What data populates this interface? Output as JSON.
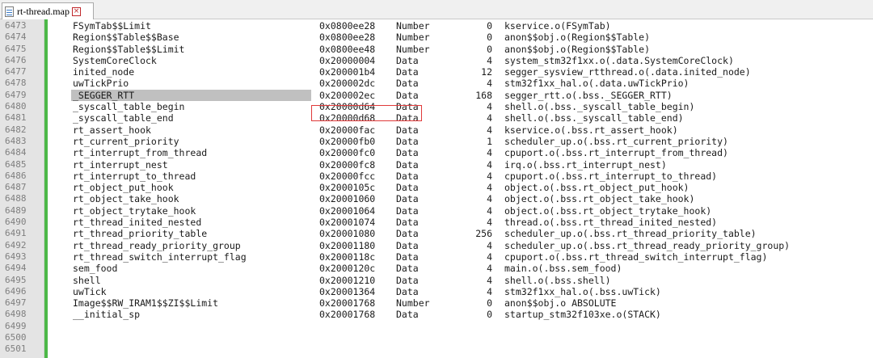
{
  "tab": {
    "title": "rt-thread.map",
    "close": "×"
  },
  "rows": [
    {
      "line": "6473",
      "symbol": "FSymTab$$Limit",
      "address": "0x0800ee28",
      "type": "Number",
      "size": "0",
      "object": "kservice.o(FSymTab)"
    },
    {
      "line": "6474",
      "symbol": "Region$$Table$$Base",
      "address": "0x0800ee28",
      "type": "Number",
      "size": "0",
      "object": "anon$$obj.o(Region$$Table)"
    },
    {
      "line": "6475",
      "symbol": "Region$$Table$$Limit",
      "address": "0x0800ee48",
      "type": "Number",
      "size": "0",
      "object": "anon$$obj.o(Region$$Table)"
    },
    {
      "line": "6476",
      "symbol": "SystemCoreClock",
      "address": "0x20000004",
      "type": "Data",
      "size": "4",
      "object": "system_stm32f1xx.o(.data.SystemCoreClock)"
    },
    {
      "line": "6477",
      "symbol": "inited_node",
      "address": "0x200001b4",
      "type": "Data",
      "size": "12",
      "object": "segger_sysview_rtthread.o(.data.inited_node)"
    },
    {
      "line": "6478",
      "symbol": "uwTickPrio",
      "address": "0x200002dc",
      "type": "Data",
      "size": "4",
      "object": "stm32f1xx_hal.o(.data.uwTickPrio)"
    },
    {
      "line": "6479",
      "symbol": "_SEGGER_RTT",
      "address": "0x200002ec",
      "type": "Data",
      "size": "168",
      "object": "segger_rtt.o(.bss._SEGGER_RTT)",
      "current": true
    },
    {
      "line": "6480",
      "symbol": "_syscall_table_begin",
      "address": "0x20000d64",
      "type": "Data",
      "size": "4",
      "object": "shell.o(.bss._syscall_table_begin)"
    },
    {
      "line": "6481",
      "symbol": "_syscall_table_end",
      "address": "0x20000d68",
      "type": "Data",
      "size": "4",
      "object": "shell.o(.bss._syscall_table_end)"
    },
    {
      "line": "6482",
      "symbol": "rt_assert_hook",
      "address": "0x20000fac",
      "type": "Data",
      "size": "4",
      "object": "kservice.o(.bss.rt_assert_hook)"
    },
    {
      "line": "6483",
      "symbol": "rt_current_priority",
      "address": "0x20000fb0",
      "type": "Data",
      "size": "1",
      "object": "scheduler_up.o(.bss.rt_current_priority)"
    },
    {
      "line": "6484",
      "symbol": "rt_interrupt_from_thread",
      "address": "0x20000fc0",
      "type": "Data",
      "size": "4",
      "object": "cpuport.o(.bss.rt_interrupt_from_thread)"
    },
    {
      "line": "6485",
      "symbol": "rt_interrupt_nest",
      "address": "0x20000fc8",
      "type": "Data",
      "size": "4",
      "object": "irq.o(.bss.rt_interrupt_nest)"
    },
    {
      "line": "6486",
      "symbol": "rt_interrupt_to_thread",
      "address": "0x20000fcc",
      "type": "Data",
      "size": "4",
      "object": "cpuport.o(.bss.rt_interrupt_to_thread)"
    },
    {
      "line": "6487",
      "symbol": "rt_object_put_hook",
      "address": "0x2000105c",
      "type": "Data",
      "size": "4",
      "object": "object.o(.bss.rt_object_put_hook)"
    },
    {
      "line": "6488",
      "symbol": "rt_object_take_hook",
      "address": "0x20001060",
      "type": "Data",
      "size": "4",
      "object": "object.o(.bss.rt_object_take_hook)"
    },
    {
      "line": "6489",
      "symbol": "rt_object_trytake_hook",
      "address": "0x20001064",
      "type": "Data",
      "size": "4",
      "object": "object.o(.bss.rt_object_trytake_hook)"
    },
    {
      "line": "6490",
      "symbol": "rt_thread_inited_nested",
      "address": "0x20001074",
      "type": "Data",
      "size": "4",
      "object": "thread.o(.bss.rt_thread_inited_nested)"
    },
    {
      "line": "6491",
      "symbol": "rt_thread_priority_table",
      "address": "0x20001080",
      "type": "Data",
      "size": "256",
      "object": "scheduler_up.o(.bss.rt_thread_priority_table)"
    },
    {
      "line": "6492",
      "symbol": "rt_thread_ready_priority_group",
      "address": "0x20001180",
      "type": "Data",
      "size": "4",
      "object": "scheduler_up.o(.bss.rt_thread_ready_priority_group)"
    },
    {
      "line": "6493",
      "symbol": "rt_thread_switch_interrupt_flag",
      "address": "0x2000118c",
      "type": "Data",
      "size": "4",
      "object": "cpuport.o(.bss.rt_thread_switch_interrupt_flag)"
    },
    {
      "line": "6494",
      "symbol": "sem_food",
      "address": "0x2000120c",
      "type": "Data",
      "size": "4",
      "object": "main.o(.bss.sem_food)"
    },
    {
      "line": "6495",
      "symbol": "shell",
      "address": "0x20001210",
      "type": "Data",
      "size": "4",
      "object": "shell.o(.bss.shell)"
    },
    {
      "line": "6496",
      "symbol": "uwTick",
      "address": "0x20001364",
      "type": "Data",
      "size": "4",
      "object": "stm32f1xx_hal.o(.bss.uwTick)"
    },
    {
      "line": "6497",
      "symbol": "Image$$RW_IRAM1$$ZI$$Limit",
      "address": "0x20001768",
      "type": "Number",
      "size": "0",
      "object": "anon$$obj.o ABSOLUTE"
    },
    {
      "line": "6498",
      "symbol": "__initial_sp",
      "address": "0x20001768",
      "type": "Data",
      "size": "0",
      "object": "startup_stm32f103xe.o(STACK)"
    },
    {
      "line": "6499",
      "symbol": "",
      "address": "",
      "type": "",
      "size": "",
      "object": ""
    },
    {
      "line": "6500",
      "symbol": "",
      "address": "",
      "type": "",
      "size": "",
      "object": ""
    },
    {
      "line": "6501",
      "symbol": "",
      "address": "",
      "type": "",
      "size": "",
      "object": ""
    }
  ]
}
